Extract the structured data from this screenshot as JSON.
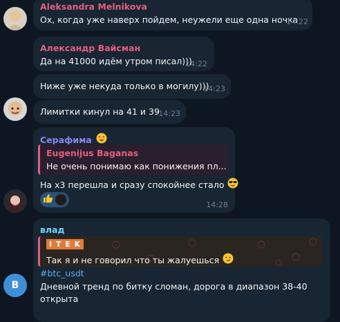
{
  "messages": [
    {
      "sender": "Aleksandra Melnikova",
      "text": "Ох, когда уже наверх пойдем, неужели еще одна ночка",
      "time": "14:22"
    },
    {
      "sender": "Александр Вайсман",
      "text": "Да на 41000 идём утром писал)))",
      "time": "14:22"
    },
    {
      "text": "Ниже уже некуда только в могилу)))",
      "time": "14:23"
    },
    {
      "text": "Лимитки кинул на 41 и 39",
      "time": "14:23"
    },
    {
      "sender": "Серафима",
      "reply": {
        "sender": "Eugenijus Baganas",
        "text": "Не очень понимаю как понижения пл..."
      },
      "text": "На х3 перешла и сразу спокойнее стало",
      "time": "14:28"
    },
    {
      "sender": "влад",
      "reply": {
        "sender": "I T E K",
        "text": "Так я и не говорил что ты жалуешься"
      },
      "hashtag": "#btc_usdt",
      "text_line1": "Дневной тренд по битку сломан, дорога в диапазон 38-40",
      "text_line2": "открыта",
      "avatar_letter": "В"
    }
  ],
  "colors": {
    "background": "#0e1621",
    "bubble": "#182533",
    "name_pink": "#e0607e",
    "name_purple": "#8e85ee",
    "name_cyan": "#72d5fd",
    "link": "#62a8e8",
    "time": "#6d7f8f",
    "reaction": "#2b5278",
    "avatar_blue": "#3e8fd8"
  }
}
